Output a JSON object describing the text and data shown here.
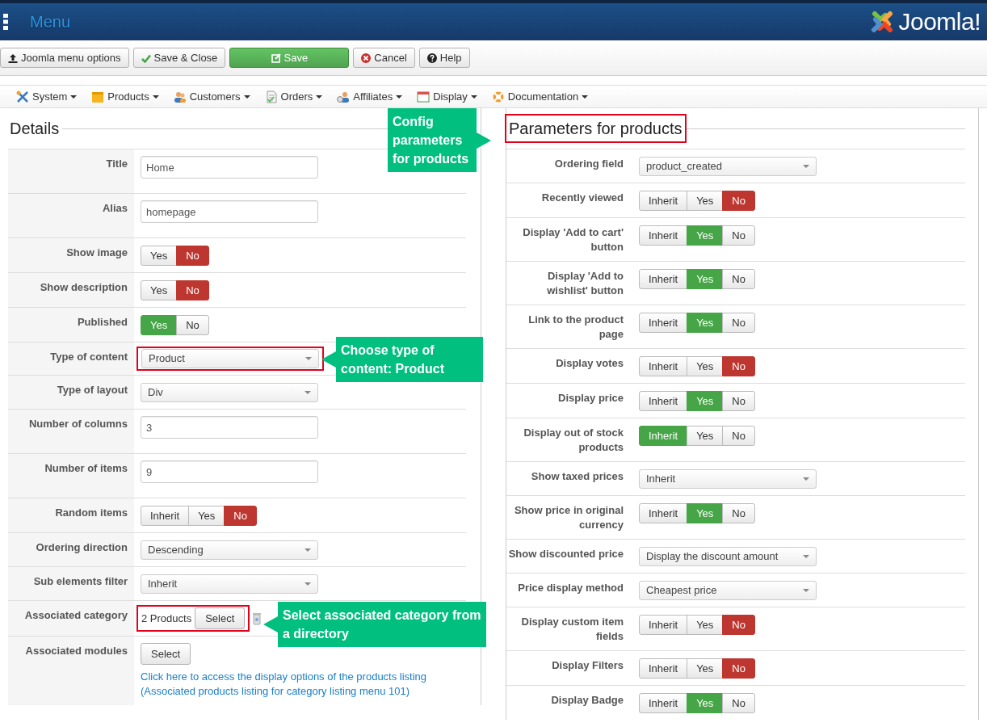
{
  "header": {
    "title": "Menu",
    "logo_text": "Joomla!"
  },
  "toolbar": [
    {
      "label": "Joomla menu options",
      "kind": "default"
    },
    {
      "label": "Save & Close",
      "kind": "default"
    },
    {
      "label": "Save",
      "kind": "success"
    },
    {
      "label": "Cancel",
      "kind": "default"
    },
    {
      "label": "Help",
      "kind": "default"
    }
  ],
  "menubar": [
    {
      "label": "System"
    },
    {
      "label": "Products"
    },
    {
      "label": "Customers"
    },
    {
      "label": "Orders"
    },
    {
      "label": "Affiliates"
    },
    {
      "label": "Display"
    },
    {
      "label": "Documentation"
    }
  ],
  "details": {
    "title": "Details",
    "rows": [
      {
        "label": "Title",
        "kind": "text",
        "value": "Home",
        "highlighted": false
      },
      {
        "label": "Alias",
        "kind": "text",
        "value": "homepage",
        "highlighted": false
      },
      {
        "label": "Show image",
        "kind": "toggle",
        "highlighted": false,
        "options": [
          {
            "label": "Yes",
            "selected": false
          },
          {
            "label": "No",
            "selected": true,
            "color": "#bd362f"
          }
        ]
      },
      {
        "label": "Show description",
        "kind": "toggle",
        "highlighted": false,
        "options": [
          {
            "label": "Yes",
            "selected": false
          },
          {
            "label": "No",
            "selected": true,
            "color": "#bd362f"
          }
        ]
      },
      {
        "label": "Published",
        "kind": "toggle",
        "highlighted": false,
        "options": [
          {
            "label": "Yes",
            "selected": true,
            "color": "#46a546"
          },
          {
            "label": "No",
            "selected": false
          }
        ]
      },
      {
        "label": "Type of content",
        "kind": "select",
        "value": "Product",
        "highlighted": true
      },
      {
        "label": "Type of layout",
        "kind": "select",
        "value": "Div",
        "highlighted": false
      },
      {
        "label": "Number of columns",
        "kind": "text",
        "value": "3",
        "highlighted": false
      },
      {
        "label": "Number of items",
        "kind": "text",
        "value": "9",
        "highlighted": false
      },
      {
        "label": "Random items",
        "kind": "toggle",
        "highlighted": false,
        "options": [
          {
            "label": "Inherit",
            "selected": false
          },
          {
            "label": "Yes",
            "selected": false
          },
          {
            "label": "No",
            "selected": true,
            "color": "#bd362f"
          }
        ]
      },
      {
        "label": "Ordering direction",
        "kind": "select",
        "value": "Descending",
        "highlighted": false
      },
      {
        "label": "Sub elements filter",
        "kind": "select",
        "value": "Inherit",
        "highlighted": false
      },
      {
        "label": "Associated category",
        "kind": "category",
        "value": "2 Products",
        "button": "Select",
        "highlighted": true
      },
      {
        "label": "Associated modules",
        "kind": "modules",
        "button": "Select",
        "link": "Click here to access the display options of the products listing (Associated products listing for category listing menu 101)",
        "highlighted": false
      }
    ]
  },
  "parameters": {
    "title": "Parameters for products",
    "highlighted": true,
    "rows": [
      {
        "label": "Ordering field",
        "kind": "select",
        "value": "product_created",
        "highlighted": false
      },
      {
        "label": "Recently viewed",
        "kind": "toggle",
        "highlighted": false,
        "options": [
          {
            "label": "Inherit",
            "selected": false
          },
          {
            "label": "Yes",
            "selected": false
          },
          {
            "label": "No",
            "selected": true,
            "color": "#bd362f"
          }
        ]
      },
      {
        "label": "Display 'Add to cart' button",
        "kind": "toggle",
        "highlighted": false,
        "options": [
          {
            "label": "Inherit",
            "selected": false
          },
          {
            "label": "Yes",
            "selected": true,
            "color": "#46a546"
          },
          {
            "label": "No",
            "selected": false
          }
        ]
      },
      {
        "label": "Display 'Add to wishlist' button",
        "kind": "toggle",
        "highlighted": false,
        "options": [
          {
            "label": "Inherit",
            "selected": false
          },
          {
            "label": "Yes",
            "selected": true,
            "color": "#46a546"
          },
          {
            "label": "No",
            "selected": false
          }
        ]
      },
      {
        "label": "Link to the product page",
        "kind": "toggle",
        "highlighted": false,
        "options": [
          {
            "label": "Inherit",
            "selected": false
          },
          {
            "label": "Yes",
            "selected": true,
            "color": "#46a546"
          },
          {
            "label": "No",
            "selected": false
          }
        ]
      },
      {
        "label": "Display votes",
        "kind": "toggle",
        "highlighted": false,
        "options": [
          {
            "label": "Inherit",
            "selected": false
          },
          {
            "label": "Yes",
            "selected": false
          },
          {
            "label": "No",
            "selected": true,
            "color": "#bd362f"
          }
        ]
      },
      {
        "label": "Display price",
        "kind": "toggle",
        "highlighted": false,
        "options": [
          {
            "label": "Inherit",
            "selected": false
          },
          {
            "label": "Yes",
            "selected": true,
            "color": "#46a546"
          },
          {
            "label": "No",
            "selected": false
          }
        ]
      },
      {
        "label": "Display out of stock products",
        "kind": "toggle",
        "highlighted": false,
        "options": [
          {
            "label": "Inherit",
            "selected": true,
            "color": "#46a546"
          },
          {
            "label": "Yes",
            "selected": false
          },
          {
            "label": "No",
            "selected": false
          }
        ]
      },
      {
        "label": "Show taxed prices",
        "kind": "select",
        "value": "Inherit",
        "highlighted": false
      },
      {
        "label": "Show price in original currency",
        "kind": "toggle",
        "highlighted": false,
        "options": [
          {
            "label": "Inherit",
            "selected": false
          },
          {
            "label": "Yes",
            "selected": true,
            "color": "#46a546"
          },
          {
            "label": "No",
            "selected": false
          }
        ]
      },
      {
        "label": "Show discounted price",
        "kind": "select",
        "value": "Display the discount amount",
        "highlighted": false
      },
      {
        "label": "Price display method",
        "kind": "select",
        "value": "Cheapest price",
        "highlighted": false
      },
      {
        "label": "Display custom item fields",
        "kind": "toggle",
        "highlighted": false,
        "options": [
          {
            "label": "Inherit",
            "selected": false
          },
          {
            "label": "Yes",
            "selected": false
          },
          {
            "label": "No",
            "selected": true,
            "color": "#bd362f"
          }
        ]
      },
      {
        "label": "Display Filters",
        "kind": "toggle",
        "highlighted": false,
        "options": [
          {
            "label": "Inherit",
            "selected": false
          },
          {
            "label": "Yes",
            "selected": false
          },
          {
            "label": "No",
            "selected": true,
            "color": "#bd362f"
          }
        ]
      },
      {
        "label": "Display Badge",
        "kind": "toggle",
        "highlighted": false,
        "options": [
          {
            "label": "Inherit",
            "selected": false
          },
          {
            "label": "Yes",
            "selected": true,
            "color": "#46a546"
          },
          {
            "label": "No",
            "selected": false
          }
        ]
      }
    ]
  },
  "callouts": [
    {
      "text": "Config parameters for products",
      "kind": "right-pointer"
    },
    {
      "text": "Choose type of content: Product",
      "kind": "left-pointer"
    },
    {
      "text": "Select associated category from a directory",
      "kind": "left-pointer"
    }
  ]
}
